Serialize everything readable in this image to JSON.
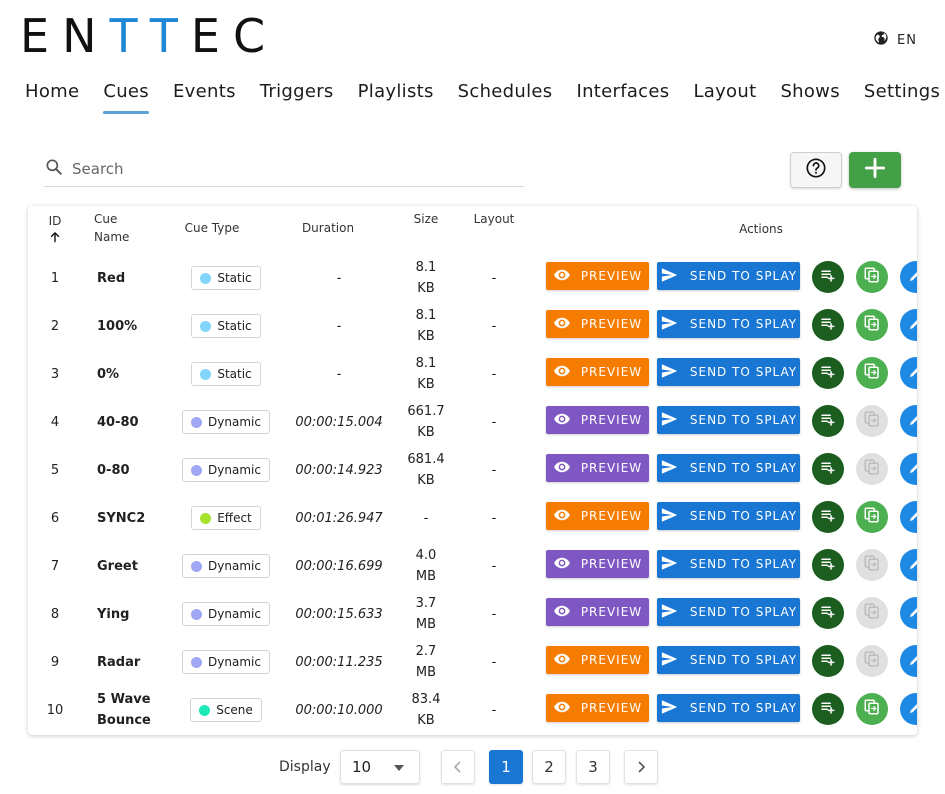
{
  "brand": {
    "logo_text_a": "EN",
    "logo_text_b": "TT",
    "logo_text_c": "EC",
    "accent_color": "#1e88d6"
  },
  "language": {
    "label": "EN"
  },
  "nav": {
    "tabs": [
      {
        "label": "Home"
      },
      {
        "label": "Cues",
        "active": true
      },
      {
        "label": "Events"
      },
      {
        "label": "Triggers"
      },
      {
        "label": "Playlists"
      },
      {
        "label": "Schedules"
      },
      {
        "label": "Interfaces"
      },
      {
        "label": "Layout"
      },
      {
        "label": "Shows"
      },
      {
        "label": "Settings"
      }
    ]
  },
  "search": {
    "placeholder": "Search",
    "value": ""
  },
  "toolbar": {
    "help_icon": "help-circle-icon",
    "add_icon": "plus-icon"
  },
  "table": {
    "headers": {
      "id": "ID",
      "name_line1": "Cue",
      "name_line2": "Name",
      "type": "Cue Type",
      "duration": "Duration",
      "size": "Size",
      "layout": "Layout",
      "actions": "Actions"
    },
    "preview_label": "PREVIEW",
    "send_label": "SEND TO SPLAY",
    "colors": {
      "preview_orange": "#f57c00",
      "preview_purple": "#7e57c2",
      "send_blue": "#1976d2",
      "playlist_green": "#1b5e20",
      "duplicate_green": "#4caf50",
      "duplicate_disabled": "#e0e0e0",
      "edit_blue": "#1e88e5"
    },
    "rows": [
      {
        "id": "1",
        "name": "Red",
        "type": "Static",
        "type_color": "#81d4fa",
        "duration": "-",
        "size_line1": "8.1",
        "size_line2": "KB",
        "layout": "-",
        "preview_color": "orange",
        "duplicate_enabled": true
      },
      {
        "id": "2",
        "name": "100%",
        "type": "Static",
        "type_color": "#81d4fa",
        "duration": "-",
        "size_line1": "8.1",
        "size_line2": "KB",
        "layout": "-",
        "preview_color": "orange",
        "duplicate_enabled": true
      },
      {
        "id": "3",
        "name": "0%",
        "type": "Static",
        "type_color": "#81d4fa",
        "duration": "-",
        "size_line1": "8.1",
        "size_line2": "KB",
        "layout": "-",
        "preview_color": "orange",
        "duplicate_enabled": true
      },
      {
        "id": "4",
        "name": "40-80",
        "type": "Dynamic",
        "type_color": "#9fa8f2",
        "duration": "00:00:15.004",
        "size_line1": "661.7",
        "size_line2": "KB",
        "layout": "-",
        "preview_color": "purple",
        "duplicate_enabled": false
      },
      {
        "id": "5",
        "name": "0-80",
        "type": "Dynamic",
        "type_color": "#9fa8f2",
        "duration": "00:00:14.923",
        "size_line1": "681.4",
        "size_line2": "KB",
        "layout": "-",
        "preview_color": "purple",
        "duplicate_enabled": false
      },
      {
        "id": "6",
        "name": "SYNC2",
        "type": "Effect",
        "type_color": "#a6e22e",
        "duration": "00:01:26.947",
        "size_line1": "-",
        "size_line2": "",
        "layout": "-",
        "preview_color": "orange",
        "duplicate_enabled": true
      },
      {
        "id": "7",
        "name": "Greet",
        "type": "Dynamic",
        "type_color": "#9fa8f2",
        "duration": "00:00:16.699",
        "size_line1": "4.0",
        "size_line2": "MB",
        "layout": "-",
        "preview_color": "purple",
        "duplicate_enabled": false
      },
      {
        "id": "8",
        "name": "Ying",
        "type": "Dynamic",
        "type_color": "#9fa8f2",
        "duration": "00:00:15.633",
        "size_line1": "3.7",
        "size_line2": "MB",
        "layout": "-",
        "preview_color": "purple",
        "duplicate_enabled": false
      },
      {
        "id": "9",
        "name": "Radar",
        "type": "Dynamic",
        "type_color": "#9fa8f2",
        "duration": "00:00:11.235",
        "size_line1": "2.7",
        "size_line2": "MB",
        "layout": "-",
        "preview_color": "orange",
        "duplicate_enabled": false
      },
      {
        "id": "10",
        "name": "5 Wave Bounce",
        "type": "Scene",
        "type_color": "#1de9b6",
        "duration": "00:00:10.000",
        "size_line1": "83.4",
        "size_line2": "KB",
        "layout": "-",
        "preview_color": "orange",
        "duplicate_enabled": true
      }
    ]
  },
  "pagination": {
    "display_label": "Display",
    "page_size": "10",
    "pages": [
      "1",
      "2",
      "3"
    ],
    "current_page": "1"
  }
}
